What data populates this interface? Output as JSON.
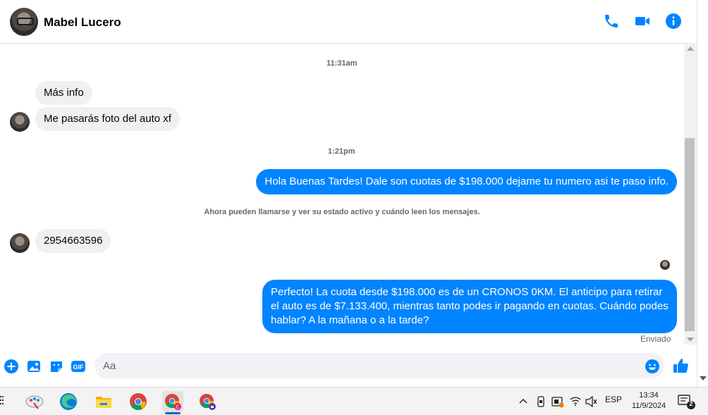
{
  "header": {
    "contact_name": "Mabel Lucero",
    "accent": "#0084ff",
    "icons": [
      "phone-icon",
      "video-camera-icon",
      "info-icon"
    ]
  },
  "conversation": {
    "timestamp_1": "11:31am",
    "incoming_1": "Más info",
    "incoming_2": "Me pasarás foto del auto xf",
    "timestamp_2": "1:21pm",
    "outgoing_1": "Hola Buenas Tardes! Dale son cuotas de $198.000 dejame tu numero asi te paso info.",
    "system_note": "Ahora pueden llamarse y ver su estado activo y cuándo leen los mensajes.",
    "incoming_3": "2954663596",
    "outgoing_2": "Perfecto! La cuota desde $198.000 es de un CRONOS 0KM. El anticipo para retirar el auto es de $7.133.400, mientras tanto podes ir pagando en cuotas. Cuándo podes hablar? A la mañana o a la tarde?",
    "status": "Enviado"
  },
  "composer": {
    "placeholder": "Aa",
    "icons": [
      "plus-circle-icon",
      "image-icon",
      "sticker-icon",
      "gif-icon",
      "emoji-icon",
      "thumbs-up-icon"
    ],
    "gif_label": "GIF"
  },
  "taskbar": {
    "apps": [
      "paint-app-icon",
      "edge-browser-icon",
      "file-explorer-icon",
      "chrome-browser-icon",
      "chrome-profile-c-icon",
      "chrome-profile-locked-icon"
    ],
    "language": "ESP",
    "time": "13:34",
    "date": "11/9/2024",
    "notification_count": "2"
  }
}
